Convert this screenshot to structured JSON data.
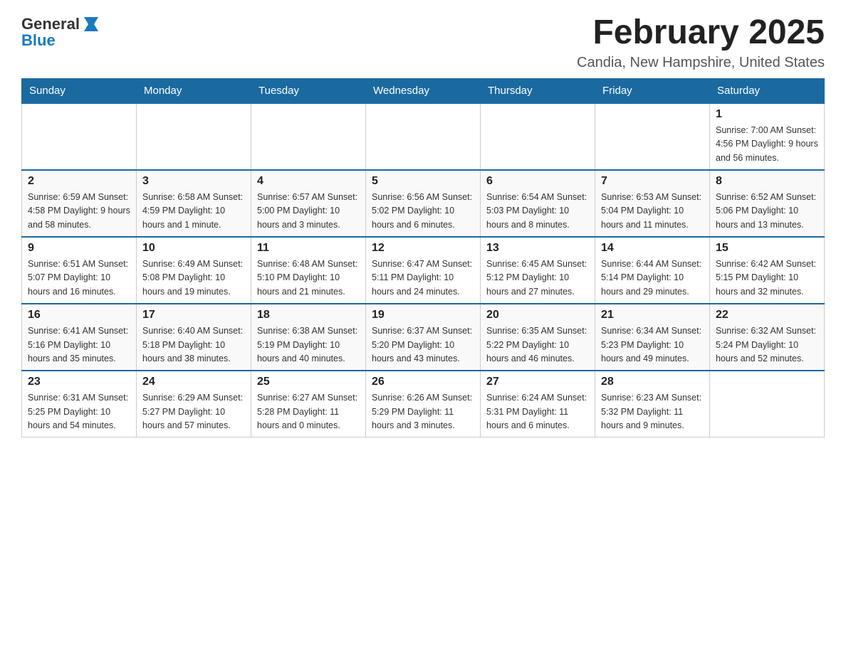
{
  "header": {
    "logo": {
      "general": "General",
      "blue": "Blue",
      "icon_label": "blue-flag-icon"
    },
    "title": "February 2025",
    "subtitle": "Candia, New Hampshire, United States"
  },
  "weekdays": [
    "Sunday",
    "Monday",
    "Tuesday",
    "Wednesday",
    "Thursday",
    "Friday",
    "Saturday"
  ],
  "weeks": [
    [
      {
        "day": "",
        "info": ""
      },
      {
        "day": "",
        "info": ""
      },
      {
        "day": "",
        "info": ""
      },
      {
        "day": "",
        "info": ""
      },
      {
        "day": "",
        "info": ""
      },
      {
        "day": "",
        "info": ""
      },
      {
        "day": "1",
        "info": "Sunrise: 7:00 AM\nSunset: 4:56 PM\nDaylight: 9 hours\nand 56 minutes."
      }
    ],
    [
      {
        "day": "2",
        "info": "Sunrise: 6:59 AM\nSunset: 4:58 PM\nDaylight: 9 hours\nand 58 minutes."
      },
      {
        "day": "3",
        "info": "Sunrise: 6:58 AM\nSunset: 4:59 PM\nDaylight: 10 hours\nand 1 minute."
      },
      {
        "day": "4",
        "info": "Sunrise: 6:57 AM\nSunset: 5:00 PM\nDaylight: 10 hours\nand 3 minutes."
      },
      {
        "day": "5",
        "info": "Sunrise: 6:56 AM\nSunset: 5:02 PM\nDaylight: 10 hours\nand 6 minutes."
      },
      {
        "day": "6",
        "info": "Sunrise: 6:54 AM\nSunset: 5:03 PM\nDaylight: 10 hours\nand 8 minutes."
      },
      {
        "day": "7",
        "info": "Sunrise: 6:53 AM\nSunset: 5:04 PM\nDaylight: 10 hours\nand 11 minutes."
      },
      {
        "day": "8",
        "info": "Sunrise: 6:52 AM\nSunset: 5:06 PM\nDaylight: 10 hours\nand 13 minutes."
      }
    ],
    [
      {
        "day": "9",
        "info": "Sunrise: 6:51 AM\nSunset: 5:07 PM\nDaylight: 10 hours\nand 16 minutes."
      },
      {
        "day": "10",
        "info": "Sunrise: 6:49 AM\nSunset: 5:08 PM\nDaylight: 10 hours\nand 19 minutes."
      },
      {
        "day": "11",
        "info": "Sunrise: 6:48 AM\nSunset: 5:10 PM\nDaylight: 10 hours\nand 21 minutes."
      },
      {
        "day": "12",
        "info": "Sunrise: 6:47 AM\nSunset: 5:11 PM\nDaylight: 10 hours\nand 24 minutes."
      },
      {
        "day": "13",
        "info": "Sunrise: 6:45 AM\nSunset: 5:12 PM\nDaylight: 10 hours\nand 27 minutes."
      },
      {
        "day": "14",
        "info": "Sunrise: 6:44 AM\nSunset: 5:14 PM\nDaylight: 10 hours\nand 29 minutes."
      },
      {
        "day": "15",
        "info": "Sunrise: 6:42 AM\nSunset: 5:15 PM\nDaylight: 10 hours\nand 32 minutes."
      }
    ],
    [
      {
        "day": "16",
        "info": "Sunrise: 6:41 AM\nSunset: 5:16 PM\nDaylight: 10 hours\nand 35 minutes."
      },
      {
        "day": "17",
        "info": "Sunrise: 6:40 AM\nSunset: 5:18 PM\nDaylight: 10 hours\nand 38 minutes."
      },
      {
        "day": "18",
        "info": "Sunrise: 6:38 AM\nSunset: 5:19 PM\nDaylight: 10 hours\nand 40 minutes."
      },
      {
        "day": "19",
        "info": "Sunrise: 6:37 AM\nSunset: 5:20 PM\nDaylight: 10 hours\nand 43 minutes."
      },
      {
        "day": "20",
        "info": "Sunrise: 6:35 AM\nSunset: 5:22 PM\nDaylight: 10 hours\nand 46 minutes."
      },
      {
        "day": "21",
        "info": "Sunrise: 6:34 AM\nSunset: 5:23 PM\nDaylight: 10 hours\nand 49 minutes."
      },
      {
        "day": "22",
        "info": "Sunrise: 6:32 AM\nSunset: 5:24 PM\nDaylight: 10 hours\nand 52 minutes."
      }
    ],
    [
      {
        "day": "23",
        "info": "Sunrise: 6:31 AM\nSunset: 5:25 PM\nDaylight: 10 hours\nand 54 minutes."
      },
      {
        "day": "24",
        "info": "Sunrise: 6:29 AM\nSunset: 5:27 PM\nDaylight: 10 hours\nand 57 minutes."
      },
      {
        "day": "25",
        "info": "Sunrise: 6:27 AM\nSunset: 5:28 PM\nDaylight: 11 hours\nand 0 minutes."
      },
      {
        "day": "26",
        "info": "Sunrise: 6:26 AM\nSunset: 5:29 PM\nDaylight: 11 hours\nand 3 minutes."
      },
      {
        "day": "27",
        "info": "Sunrise: 6:24 AM\nSunset: 5:31 PM\nDaylight: 11 hours\nand 6 minutes."
      },
      {
        "day": "28",
        "info": "Sunrise: 6:23 AM\nSunset: 5:32 PM\nDaylight: 11 hours\nand 9 minutes."
      },
      {
        "day": "",
        "info": ""
      }
    ]
  ]
}
